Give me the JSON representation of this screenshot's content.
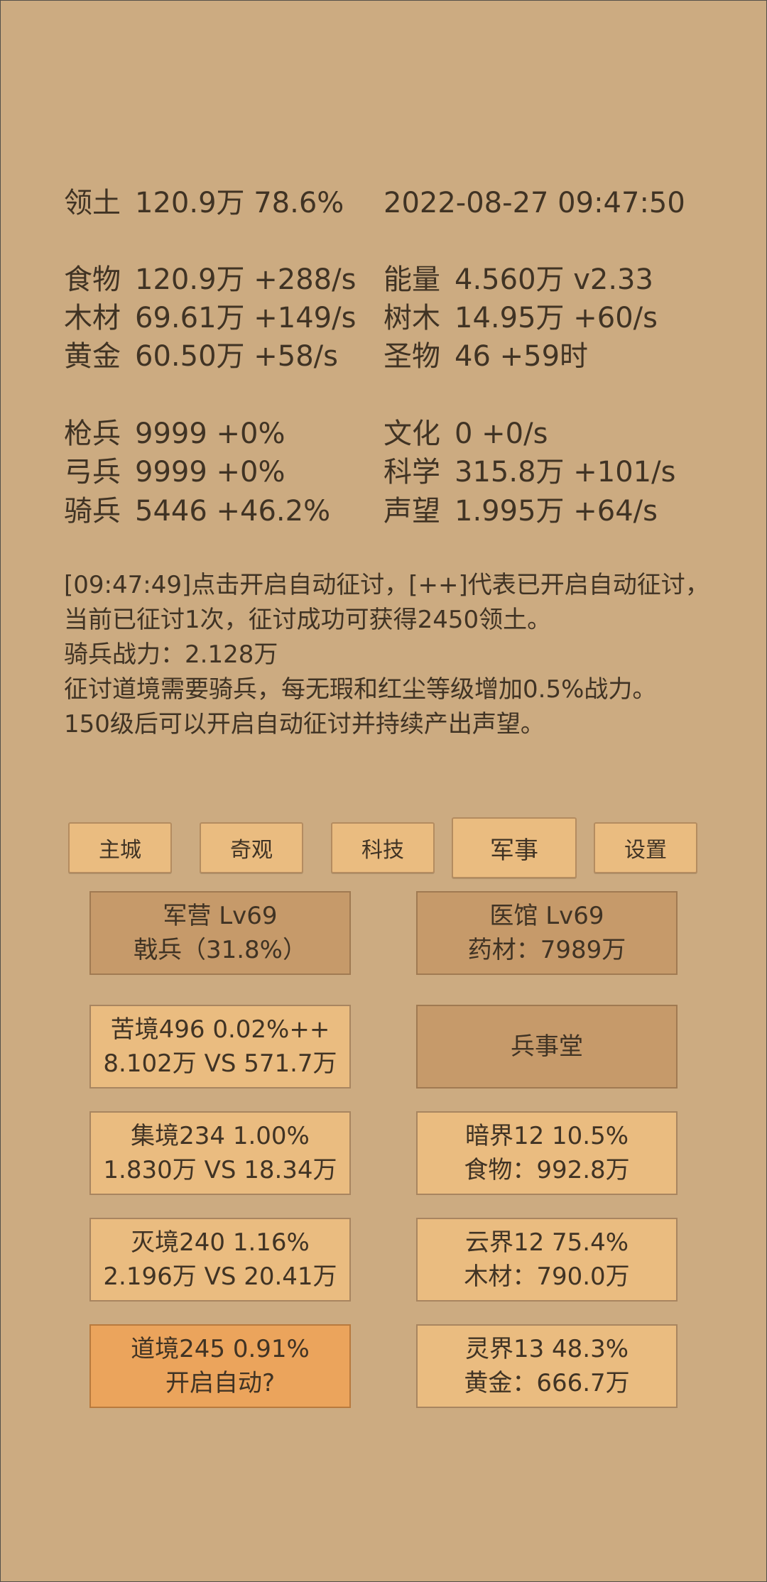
{
  "stats": {
    "territory": {
      "label": "领土",
      "value": "120.9万  78.6%"
    },
    "datetime": "2022-08-27 09:47:50",
    "food": {
      "label": "食物",
      "value": "120.9万 +288/s"
    },
    "energy": {
      "label": "能量",
      "value": "4.560万  v2.33"
    },
    "wood": {
      "label": "木材",
      "value": "69.61万 +149/s"
    },
    "trees": {
      "label": "树木",
      "value": "14.95万 +60/s"
    },
    "gold": {
      "label": "黄金",
      "value": "60.50万 +58/s"
    },
    "relic": {
      "label": "圣物",
      "value": "46 +59时"
    },
    "spearman": {
      "label": "枪兵",
      "value": "9999 +0%"
    },
    "culture": {
      "label": "文化",
      "value": "0 +0/s"
    },
    "archer": {
      "label": "弓兵",
      "value": "9999 +0%"
    },
    "science": {
      "label": "科学",
      "value": "315.8万 +101/s"
    },
    "cavalry": {
      "label": "骑兵",
      "value": "5446 +46.2%"
    },
    "prestige": {
      "label": "声望",
      "value": "1.995万 +64/s"
    }
  },
  "message": {
    "line1": "[09:47:49]点击开启自动征讨，[++]代表已开启自动征讨，",
    "line2": "当前已征讨1次，征讨成功可获得2450领土。",
    "line3": "骑兵战力：2.128万",
    "line4": "征讨道境需要骑兵，每无瑕和红尘等级增加0.5%战力。",
    "line5": "150级后可以开启自动征讨并持续产出声望。"
  },
  "tabs": {
    "main_city": "主城",
    "wonders": "奇观",
    "tech": "科技",
    "military": "军事",
    "settings": "设置"
  },
  "cards": {
    "barracks": {
      "line1": "军营 Lv69",
      "line2": "戟兵（31.8%）"
    },
    "clinic": {
      "line1": "医馆 Lv69",
      "line2": "药材：7989万"
    },
    "kujing": {
      "line1": "苦境496  0.02%++",
      "line2": "8.102万 VS 571.7万"
    },
    "bingshitang": {
      "line1": "兵事堂"
    },
    "jijing": {
      "line1": "集境234  1.00%",
      "line2": "1.830万 VS 18.34万"
    },
    "anjie": {
      "line1": "暗界12  10.5%",
      "line2": "食物：992.8万"
    },
    "miejing": {
      "line1": "灭境240  1.16%",
      "line2": "2.196万 VS 20.41万"
    },
    "yunjie": {
      "line1": "云界12  75.4%",
      "line2": "木材：790.0万"
    },
    "daojing": {
      "line1": "道境245  0.91%",
      "line2": "开启自动?"
    },
    "lingjie": {
      "line1": "灵界13  48.3%",
      "line2": "黄金：666.7万"
    }
  },
  "colors": {
    "background": "#ccab81",
    "button": "#eabc80",
    "button_dark": "#c69a6a",
    "button_highlight": "#eba45c",
    "text": "#403324"
  }
}
